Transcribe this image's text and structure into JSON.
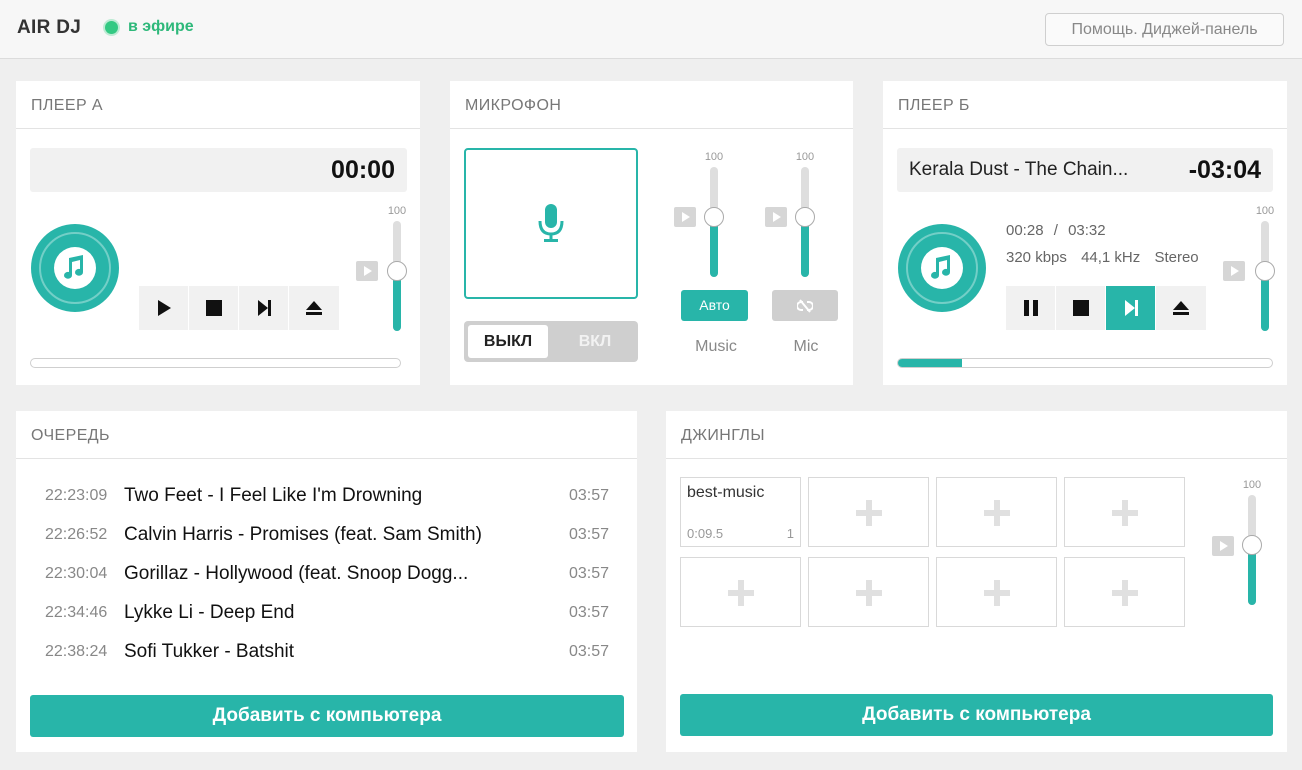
{
  "app": {
    "title": "AIR DJ",
    "status": "в эфире",
    "help_label": "Помощь. Диджей-панель"
  },
  "player_a": {
    "title": "ПЛЕЕР А",
    "time": "00:00",
    "volume": 100,
    "volume_level": 0.55,
    "progress": 0,
    "controls": [
      "play-icon",
      "stop-icon",
      "next-icon",
      "eject-icon"
    ]
  },
  "microphone": {
    "title": "МИКРОФОН",
    "switch_off": "ВЫКЛ",
    "switch_on": "ВКЛ",
    "music": {
      "label": "Music",
      "volume": 100,
      "level": 0.55,
      "mode": "Авто"
    },
    "mic": {
      "label": "Mic",
      "volume": 100,
      "level": 0.55
    }
  },
  "player_b": {
    "title": "ПЛЕЕР Б",
    "track": "Kerala Dust - The Chain...",
    "time": "-03:04",
    "position": "00:28",
    "separator": "/",
    "duration": "03:32",
    "bitrate": "320 kbps",
    "samplerate": "44,1 kHz",
    "channels": "Stereo",
    "volume": 100,
    "volume_level": 0.55,
    "progress": 0.17,
    "controls": [
      "pause-icon",
      "stop-icon",
      "next-icon",
      "eject-icon"
    ]
  },
  "queue": {
    "title": "ОЧЕРЕДЬ",
    "items": [
      {
        "time": "22:23:09",
        "title": "Two Feet - I Feel Like I'm Drowning",
        "duration": "03:57"
      },
      {
        "time": "22:26:52",
        "title": "Calvin Harris - Promises (feat. Sam Smith)",
        "duration": "03:57"
      },
      {
        "time": "22:30:04",
        "title": "Gorillaz - Hollywood (feat. Snoop Dogg...",
        "duration": "03:57"
      },
      {
        "time": "22:34:46",
        "title": "Lykke Li - Deep End",
        "duration": "03:57"
      },
      {
        "time": "22:38:24",
        "title": "Sofi Tukker - Batshit",
        "duration": "03:57"
      }
    ],
    "add_label": "Добавить с компьютера"
  },
  "jingles": {
    "title": "ДЖИНГЛЫ",
    "first": {
      "name": "best-music",
      "duration": "0:09.5",
      "key": "1"
    },
    "volume": 100,
    "volume_level": 0.55,
    "add_label": "Добавить с компьютера"
  },
  "colors": {
    "accent": "#28b5a9",
    "live": "#33c983"
  }
}
